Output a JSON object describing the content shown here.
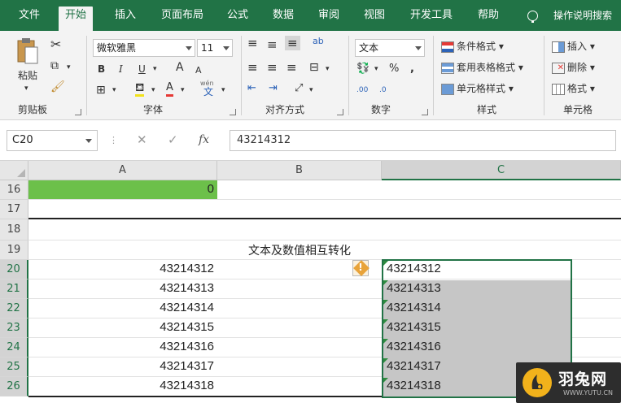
{
  "ribbon_tabs": [
    "文件",
    "开始",
    "插入",
    "页面布局",
    "公式",
    "数据",
    "审阅",
    "视图",
    "开发工具",
    "帮助"
  ],
  "active_tab": "开始",
  "tell_me": "操作说明搜索",
  "clipboard": {
    "paste_label": "粘贴",
    "group_label": "剪贴板",
    "cut_icon": "scissors-icon",
    "copy_icon": "copy-icon",
    "format_painter_icon": "brush-icon"
  },
  "font": {
    "name": "微软雅黑",
    "size": "11",
    "bold": "B",
    "italic": "I",
    "underline": "U",
    "grow": "A",
    "shrink": "A",
    "font_color": "A",
    "phonetic": "wén",
    "phonetic_char": "文",
    "group_label": "字体"
  },
  "alignment": {
    "wrap_label": "ab",
    "group_label": "对齐方式"
  },
  "number": {
    "format": "文本",
    "percent": "%",
    "comma": ",",
    "inc_decimal": ".00",
    "dec_decimal": ".0",
    "group_label": "数字"
  },
  "styles": {
    "conditional": "条件格式",
    "table": "套用表格格式",
    "cell_styles": "单元格样式",
    "group_label": "样式"
  },
  "cells_group": {
    "insert": "插入",
    "delete": "删除",
    "format": "格式",
    "group_label": "单元格"
  },
  "formula_bar": {
    "name_box": "C20",
    "cancel": "✕",
    "enter": "✓",
    "fx": "fx",
    "value": "43214312"
  },
  "columns": [
    "A",
    "B",
    "C"
  ],
  "rows": [
    "16",
    "17",
    "18",
    "19",
    "20",
    "21",
    "22",
    "23",
    "24",
    "25",
    "26"
  ],
  "cell_A16": "0",
  "title_B19": "文本及数值相互转化",
  "column_B_values": [
    "43214312",
    "43214313",
    "43214314",
    "43214315",
    "43214316",
    "43214317",
    "43214318"
  ],
  "column_C_values": [
    "43214312",
    "43214313",
    "43214314",
    "43214315",
    "43214316",
    "43214317",
    "43214318"
  ],
  "error_indicator": "!",
  "watermark": {
    "title": "羽兔网",
    "url": "WWW.YUTU.CN"
  },
  "colors": {
    "excel_green": "#217346",
    "highlight_green": "#6cc04a",
    "selection_gray": "#c6c6c6",
    "warning_orange": "#e8a33a"
  }
}
